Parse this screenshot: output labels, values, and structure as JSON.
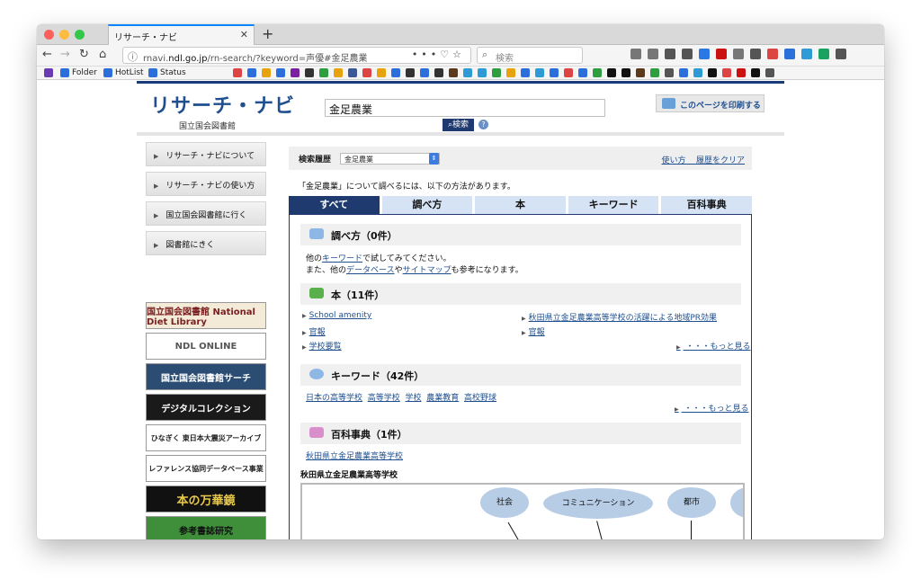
{
  "browser": {
    "tab_title": "リサーチ・ナビ",
    "url_prefix": "rnavi.",
    "url_host": "ndl.go.jp",
    "url_path": "/rn-search/?keyword=声優#金足農業",
    "search_placeholder": "検索",
    "bookmarks": [
      "Folder",
      "HotList",
      "Status"
    ]
  },
  "header": {
    "logo_title": "リサーチ・ナビ",
    "logo_subtitle": "国立国会図書館",
    "query_value": "金足農業",
    "search_button": "検索",
    "print_button": "このページを印刷する"
  },
  "sidebar": {
    "items": [
      {
        "label": "リサーチ・ナビについて"
      },
      {
        "label": "リサーチ・ナビの使い方"
      },
      {
        "label": "国立国会図書館に行く"
      },
      {
        "label": "図書館にきく"
      }
    ],
    "banners": [
      {
        "label": "国立国会図書館 National Diet Library",
        "bg": "#f3ead8",
        "color": "#7a1f1f"
      },
      {
        "label": "NDL ONLINE",
        "bg": "#ffffff",
        "color": "#555555"
      },
      {
        "label": "国立国会図書館サーチ",
        "bg": "#2b4d73",
        "color": "#ffffff"
      },
      {
        "label": "デジタルコレクション",
        "bg": "#1a1a1a",
        "color": "#ffffff"
      },
      {
        "label": "ひなぎく 東日本大震災アーカイブ",
        "bg": "#ffffff",
        "color": "#222222"
      },
      {
        "label": "レファレンス協同データベース事業",
        "bg": "#ffffff",
        "color": "#222222"
      },
      {
        "label": "本の万華鏡",
        "bg": "#111111",
        "color": "#e9c949"
      },
      {
        "label": "参考書誌研究",
        "bg": "#3f8f3a",
        "color": "#111111"
      }
    ]
  },
  "history": {
    "label": "検索履歴",
    "selected": "金足農業",
    "usage_link": "使い方",
    "clear_link": "履歴をクリア"
  },
  "intro_text": "「金足農業」について調べるには、以下の方法があります。",
  "tabs": [
    {
      "label": "すべて",
      "active": true
    },
    {
      "label": "調べ方",
      "active": false
    },
    {
      "label": "本",
      "active": false
    },
    {
      "label": "キーワード",
      "active": false
    },
    {
      "label": "百科事典",
      "active": false
    }
  ],
  "sections": {
    "howto": {
      "title": "調べ方（0件）",
      "line1_pre": "他の",
      "line1_link": "キーワード",
      "line1_post": "で試してみてください。",
      "line2_pre": "また、他の",
      "line2_link1": "データベース",
      "line2_mid": "や",
      "line2_link2": "サイトマップ",
      "line2_post": "も参考になります。"
    },
    "books": {
      "title": "本（11件）",
      "left": [
        "School amenity",
        "官報",
        "学校要覧"
      ],
      "right": [
        "秋田県立金足農業高等学校の活躍による地域PR効果",
        "官報"
      ],
      "more": "・・・もっと見る"
    },
    "keywords": {
      "title": "キーワード（42件）",
      "items": [
        "日本の高等学校",
        "高等学校",
        "学校",
        "農業教育",
        "高校野球"
      ],
      "more": "・・・もっと見る"
    },
    "encyclopedia": {
      "title": "百科事典（1件）",
      "link": "秋田県立金足農業高等学校",
      "subheading": "秋田県立金足農業高等学校",
      "map_nodes": [
        "社会",
        "コミュニケーション",
        "都市"
      ]
    }
  }
}
